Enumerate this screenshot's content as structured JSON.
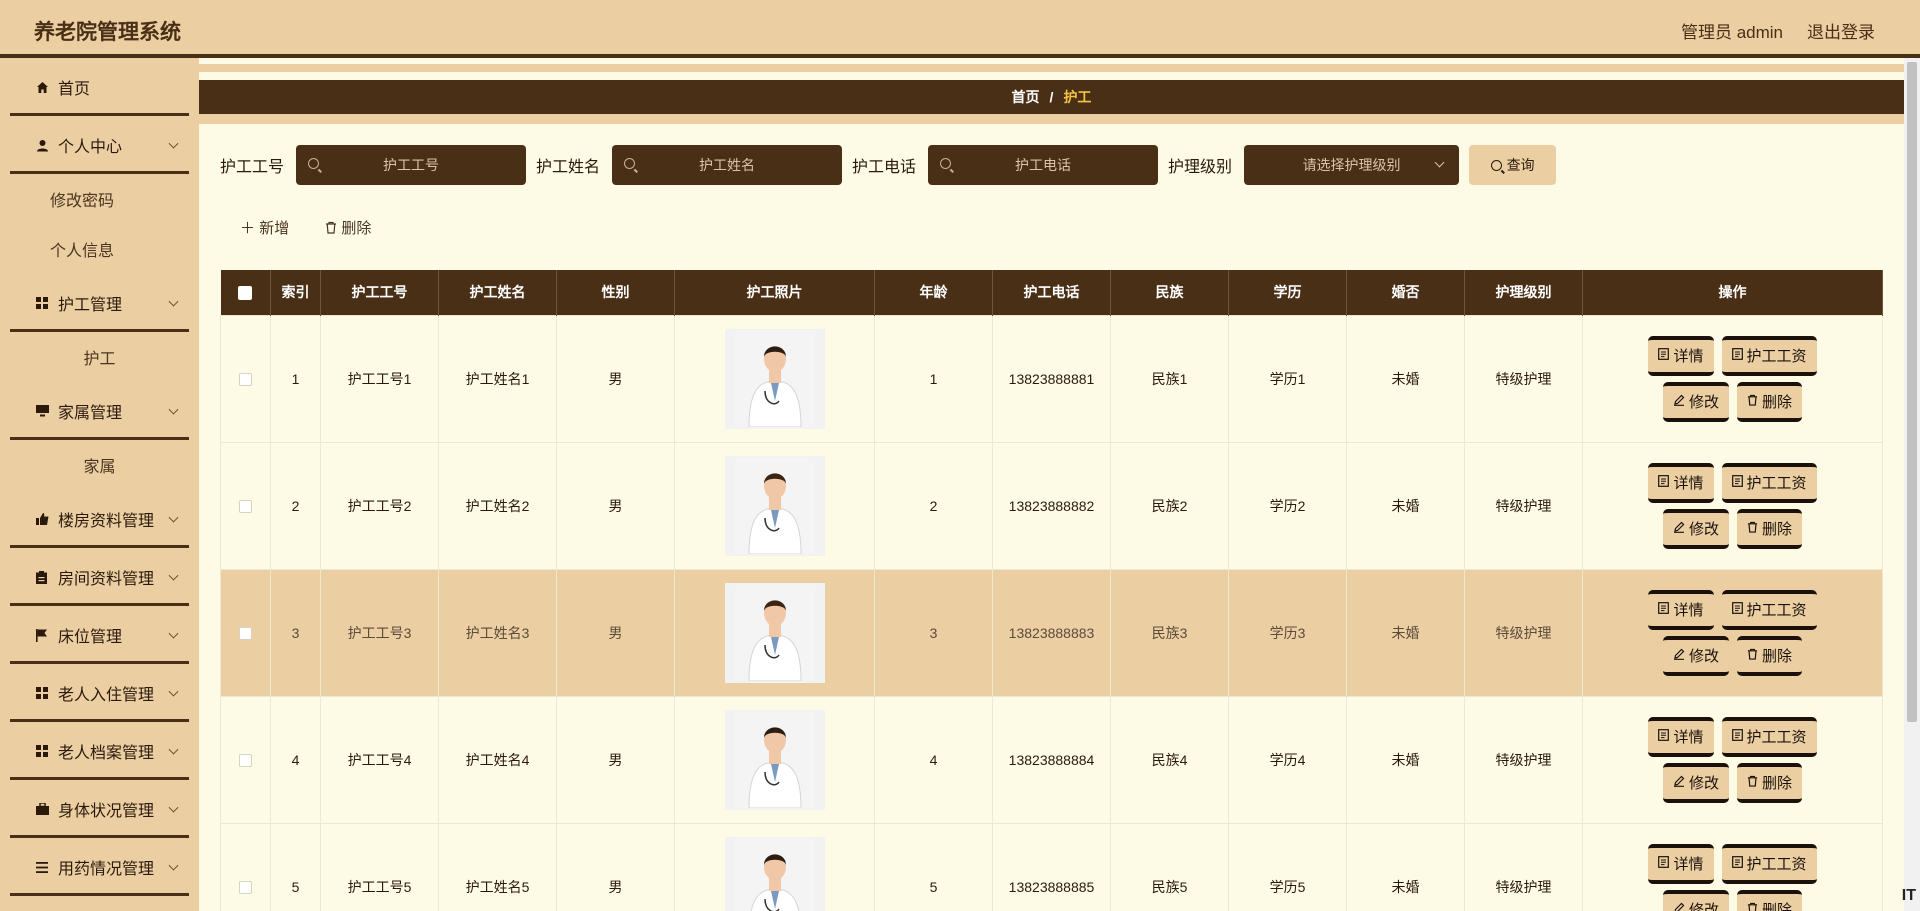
{
  "header": {
    "title": "养老院管理系统",
    "admin_label": "管理员 admin",
    "logout_label": "退出登录"
  },
  "sidebar": {
    "items": [
      {
        "label": "首页",
        "icon": "home-icon",
        "expandable": false
      },
      {
        "label": "个人中心",
        "icon": "user-icon",
        "expandable": true
      },
      {
        "label": "修改密码",
        "sub": true
      },
      {
        "label": "个人信息",
        "sub": true
      },
      {
        "label": "护工管理",
        "icon": "grid-icon",
        "expandable": true
      },
      {
        "label": "护工",
        "sub": true
      },
      {
        "label": "家属管理",
        "icon": "monitor-icon",
        "expandable": true
      },
      {
        "label": "家属",
        "sub": true
      },
      {
        "label": "楼房资料管理",
        "icon": "thumb-icon",
        "expandable": true
      },
      {
        "label": "房间资料管理",
        "icon": "clipboard-icon",
        "expandable": true
      },
      {
        "label": "床位管理",
        "icon": "flag-icon",
        "expandable": true
      },
      {
        "label": "老人入住管理",
        "icon": "grid-icon",
        "expandable": true
      },
      {
        "label": "老人档案管理",
        "icon": "grid-icon",
        "expandable": true
      },
      {
        "label": "身体状况管理",
        "icon": "briefcase-icon",
        "expandable": true
      },
      {
        "label": "用药情况管理",
        "icon": "menu-icon",
        "expandable": true
      }
    ]
  },
  "breadcrumb": {
    "home": "首页",
    "separator": "/",
    "current": "护工"
  },
  "search": {
    "id_label": "护工工号",
    "id_placeholder": "护工工号",
    "name_label": "护工姓名",
    "name_placeholder": "护工姓名",
    "phone_label": "护工电话",
    "phone_placeholder": "护工电话",
    "level_label": "护理级别",
    "level_placeholder": "请选择护理级别",
    "query_label": "查询"
  },
  "actions": {
    "add_label": "新增",
    "delete_label": "删除"
  },
  "table": {
    "columns": [
      "索引",
      "护工工号",
      "护工姓名",
      "性别",
      "护工照片",
      "年龄",
      "护工电话",
      "民族",
      "学历",
      "婚否",
      "护理级别",
      "操作"
    ],
    "rows": [
      {
        "index": "1",
        "id": "护工工号1",
        "name": "护工姓名1",
        "gender": "男",
        "age": "1",
        "phone": "13823888881",
        "ethnicity": "民族1",
        "education": "学历1",
        "married": "未婚",
        "level": "特级护理"
      },
      {
        "index": "2",
        "id": "护工工号2",
        "name": "护工姓名2",
        "gender": "男",
        "age": "2",
        "phone": "13823888882",
        "ethnicity": "民族2",
        "education": "学历2",
        "married": "未婚",
        "level": "特级护理"
      },
      {
        "index": "3",
        "id": "护工工号3",
        "name": "护工姓名3",
        "gender": "男",
        "age": "3",
        "phone": "13823888883",
        "ethnicity": "民族3",
        "education": "学历3",
        "married": "未婚",
        "level": "特级护理"
      },
      {
        "index": "4",
        "id": "护工工号4",
        "name": "护工姓名4",
        "gender": "男",
        "age": "4",
        "phone": "13823888884",
        "ethnicity": "民族4",
        "education": "学历4",
        "married": "未婚",
        "level": "特级护理"
      },
      {
        "index": "5",
        "id": "护工工号5",
        "name": "护工姓名5",
        "gender": "男",
        "age": "5",
        "phone": "13823888885",
        "ethnicity": "民族5",
        "education": "学历5",
        "married": "未婚",
        "level": "特级护理"
      }
    ],
    "op_labels": {
      "detail": "详情",
      "wage": "护工工资",
      "edit": "修改",
      "delete": "删除"
    }
  },
  "watermark": "IT",
  "colors": {
    "primary_dark": "#4a2f17",
    "accent_tan": "#ebcfa3",
    "background": "#fdfbe6",
    "highlight_text": "#f5c342"
  }
}
